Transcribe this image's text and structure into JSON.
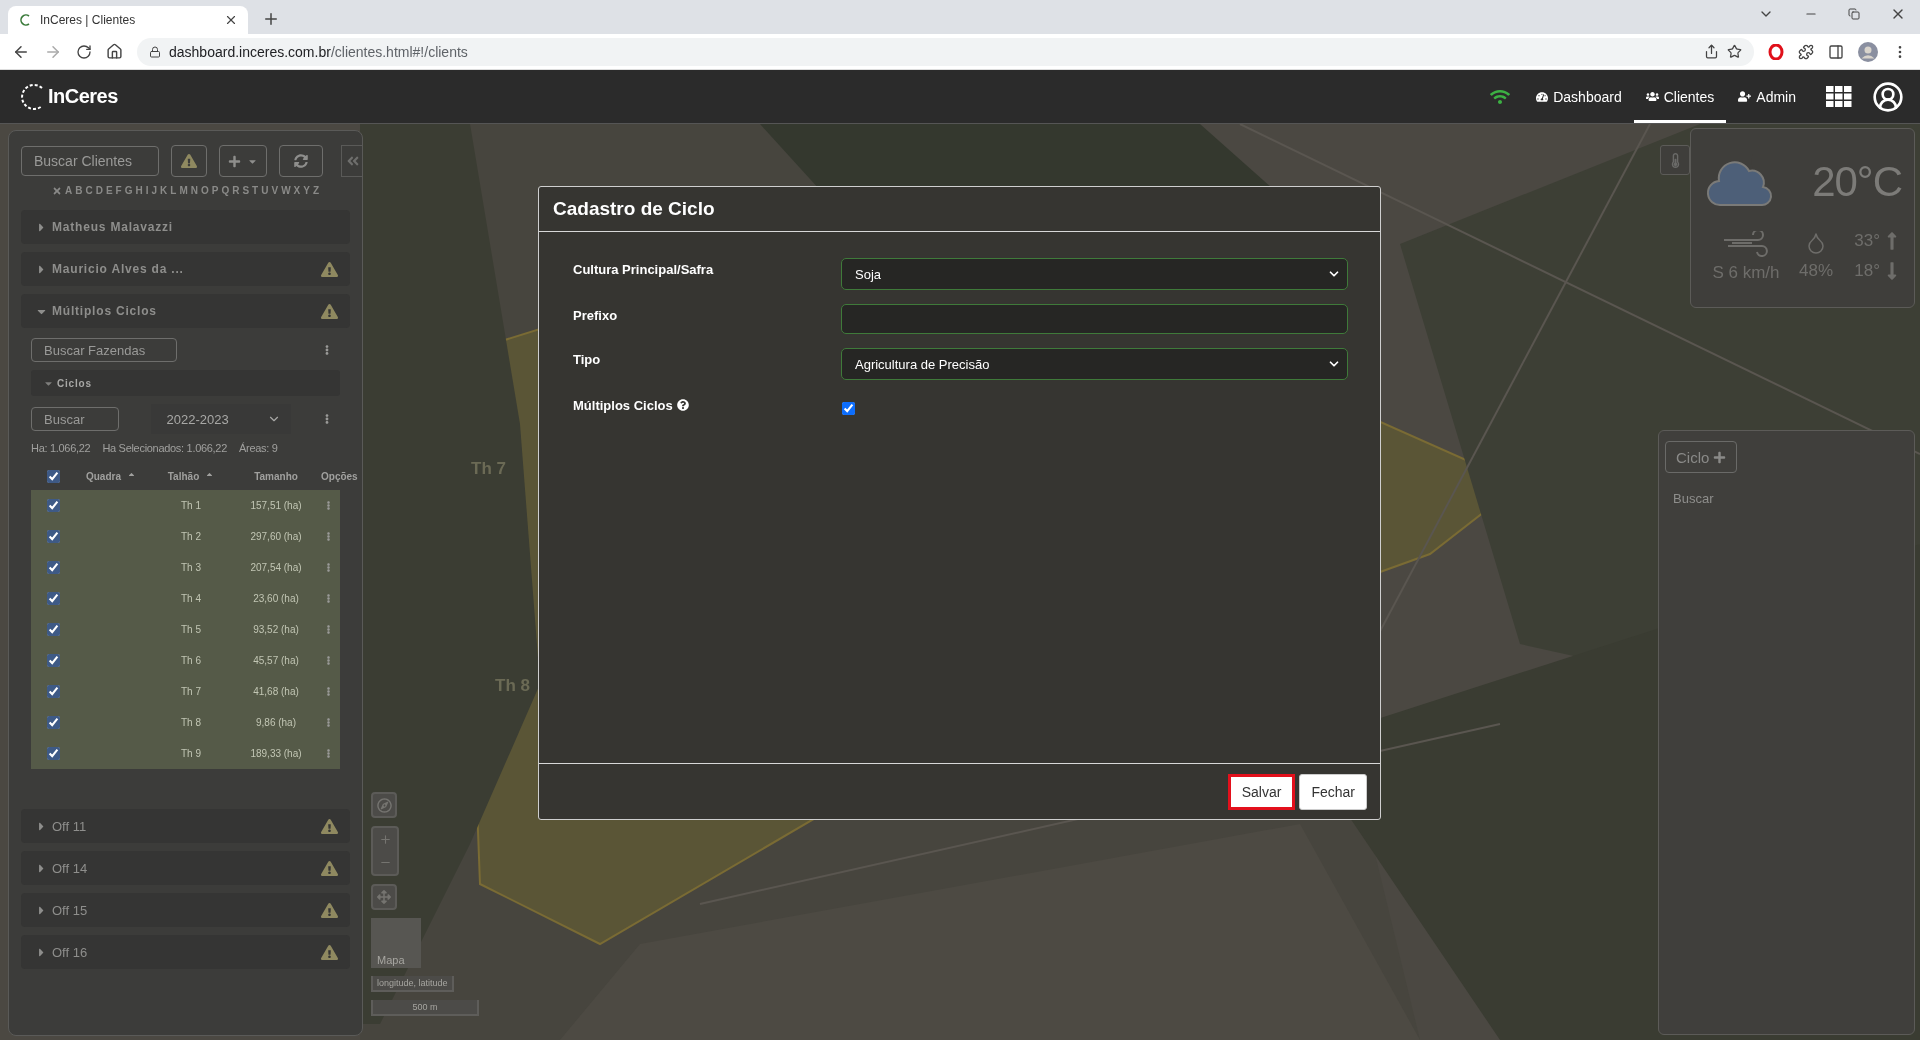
{
  "browser": {
    "tab_title": "InCeres | Clientes",
    "url_host": "dashboard.inceres.com.br",
    "url_path": "/clientes.html#!/clients"
  },
  "header": {
    "logo": "InCeres",
    "nav": [
      {
        "label": "Dashboard",
        "kind": "gauge",
        "selected": false
      },
      {
        "label": "Clientes",
        "kind": "users",
        "selected": true
      },
      {
        "label": "Admin",
        "kind": "useradd",
        "selected": false
      }
    ]
  },
  "sidebar": {
    "search_placeholder": "Buscar Clientes",
    "alphabet": [
      "A",
      "B",
      "C",
      "D",
      "E",
      "F",
      "G",
      "H",
      "I",
      "J",
      "K",
      "L",
      "M",
      "N",
      "O",
      "P",
      "Q",
      "R",
      "S",
      "T",
      "U",
      "V",
      "W",
      "X",
      "Y",
      "Z"
    ],
    "clients": [
      {
        "name": "Matheus Malavazzi",
        "kind": "strong",
        "expanded": false,
        "warning": false
      },
      {
        "name": "Mauricio Alves da ...",
        "kind": "strong",
        "expanded": false,
        "warning": true
      },
      {
        "name": "Múltiplos Ciclos",
        "kind": "strong",
        "expanded": true,
        "warning": true
      },
      {
        "name": "Off 11",
        "kind": "plain",
        "expanded": false,
        "warning": true
      },
      {
        "name": "Off 14",
        "kind": "plain",
        "expanded": false,
        "warning": true
      },
      {
        "name": "Off 15",
        "kind": "plain",
        "expanded": false,
        "warning": true
      },
      {
        "name": "Off 16",
        "kind": "plain",
        "expanded": false,
        "warning": true
      }
    ],
    "farm_search_placeholder": "Buscar Fazendas",
    "cycles": {
      "title": "Ciclos",
      "expanded": true,
      "search_placeholder": "Buscar",
      "season": "2022-2023",
      "stats": [
        "Ha: 1.066,22",
        "Ha Selecionados: 1.066,22",
        "Áreas: 9"
      ],
      "all_checked": true,
      "columns": [
        {
          "label": "Quadra",
          "sortable": true
        },
        {
          "label": "Talhão",
          "sortable": true
        },
        {
          "label": "Tamanho",
          "sortable": false
        },
        {
          "label": "Opções",
          "sortable": false
        }
      ],
      "rows": [
        {
          "plot": "Th 1",
          "size": "157,51 (ha)",
          "checked": true
        },
        {
          "plot": "Th 2",
          "size": "297,60 (ha)",
          "checked": true
        },
        {
          "plot": "Th 3",
          "size": "207,54 (ha)",
          "checked": true
        },
        {
          "plot": "Th 4",
          "size": "23,60 (ha)",
          "checked": true
        },
        {
          "plot": "Th 5",
          "size": "93,52 (ha)",
          "checked": true
        },
        {
          "plot": "Th 6",
          "size": "45,57 (ha)",
          "checked": true
        },
        {
          "plot": "Th 7",
          "size": "41,68 (ha)",
          "checked": true
        },
        {
          "plot": "Th 8",
          "size": "9,86 (ha)",
          "checked": true
        },
        {
          "plot": "Th 9",
          "size": "189,33 (ha)",
          "checked": true
        }
      ]
    }
  },
  "map": {
    "labels": [
      "Th 7",
      "Th 8"
    ],
    "minimap_label": "Mapa",
    "coordinates": "longitude, latitude",
    "scale": "500 m"
  },
  "weather": {
    "temperature": "20°C",
    "wind": "S 6 km/h",
    "humidity": "48%",
    "max": "33°",
    "min": "18°"
  },
  "cycle_panel": {
    "button": "Ciclo",
    "search_placeholder": "Buscar"
  },
  "modal": {
    "title": "Cadastro de Ciclo",
    "fields": [
      {
        "label": "Cultura Principal/Safra",
        "kind": "select",
        "value": "Soja"
      },
      {
        "label": "Prefixo",
        "kind": "text"
      },
      {
        "label": "Tipo",
        "kind": "select",
        "value": "Agricultura de Precisão"
      },
      {
        "label": "Múltiplos Ciclos",
        "kind": "checkbox",
        "checked": true,
        "help": true
      }
    ],
    "buttons": [
      {
        "label": "Salvar",
        "highlighted": true
      },
      {
        "label": "Fechar",
        "highlighted": false
      }
    ]
  }
}
